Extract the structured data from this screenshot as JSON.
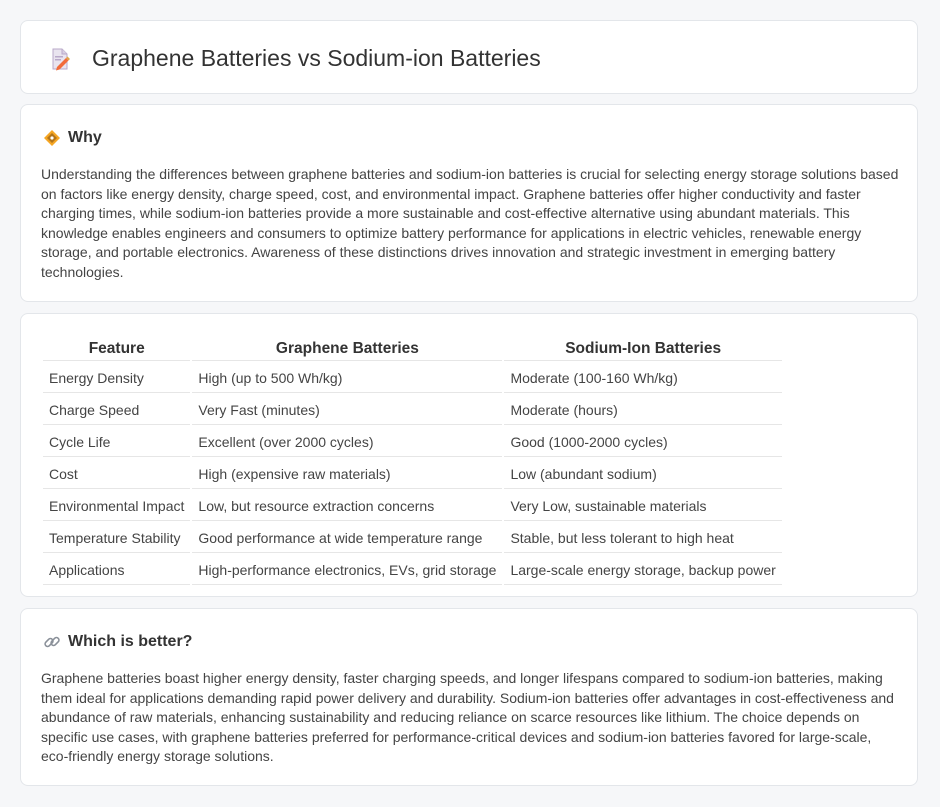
{
  "header": {
    "title": "Graphene Batteries vs Sodium-ion Batteries",
    "icon": "document-pencil-icon"
  },
  "why": {
    "heading": "Why",
    "icon": "diamond-icon",
    "text": "Understanding the differences between graphene batteries and sodium-ion batteries is crucial for selecting energy storage solutions based on factors like energy density, charge speed, cost, and environmental impact. Graphene batteries offer higher conductivity and faster charging times, while sodium-ion batteries provide a more sustainable and cost-effective alternative using abundant materials. This knowledge enables engineers and consumers to optimize battery performance for applications in electric vehicles, renewable energy storage, and portable electronics. Awareness of these distinctions drives innovation and strategic investment in emerging battery technologies."
  },
  "table": {
    "headers": [
      "Feature",
      "Graphene Batteries",
      "Sodium-Ion Batteries"
    ],
    "rows": [
      [
        "Energy Density",
        "High (up to 500 Wh/kg)",
        "Moderate (100-160 Wh/kg)"
      ],
      [
        "Charge Speed",
        "Very Fast (minutes)",
        "Moderate (hours)"
      ],
      [
        "Cycle Life",
        "Excellent (over 2000 cycles)",
        "Good (1000-2000 cycles)"
      ],
      [
        "Cost",
        "High (expensive raw materials)",
        "Low (abundant sodium)"
      ],
      [
        "Environmental Impact",
        "Low, but resource extraction concerns",
        "Very Low, sustainable materials"
      ],
      [
        "Temperature Stability",
        "Good performance at wide temperature range",
        "Stable, but less tolerant to high heat"
      ],
      [
        "Applications",
        "High-performance electronics, EVs, grid storage",
        "Large-scale energy storage, backup power"
      ]
    ]
  },
  "better": {
    "heading": "Which is better?",
    "icon": "link-icon",
    "text": "Graphene batteries boast higher energy density, faster charging speeds, and longer lifespans compared to sodium-ion batteries, making them ideal for applications demanding rapid power delivery and durability. Sodium-ion batteries offer advantages in cost-effectiveness and abundance of raw materials, enhancing sustainability and reducing reliance on scarce resources like lithium. The choice depends on specific use cases, with graphene batteries preferred for performance-critical devices and sodium-ion batteries favored for large-scale, eco-friendly energy storage solutions."
  }
}
